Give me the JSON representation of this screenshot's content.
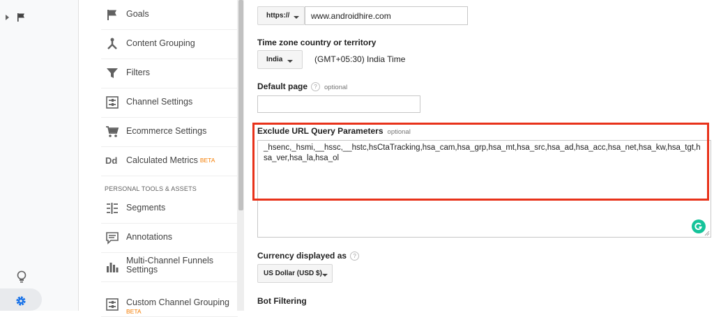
{
  "rail": {
    "icons": [
      "expand-caret-icon",
      "flag-icon",
      "lightbulb-icon",
      "gear-icon"
    ]
  },
  "nav": {
    "items": [
      {
        "label": "Goals",
        "icon": "flag-icon"
      },
      {
        "label": "Content Grouping",
        "icon": "content-grouping-icon"
      },
      {
        "label": "Filters",
        "icon": "funnel-icon"
      },
      {
        "label": "Channel Settings",
        "icon": "channel-settings-icon"
      },
      {
        "label": "Ecommerce Settings",
        "icon": "cart-icon"
      },
      {
        "label": "Calculated Metrics",
        "icon": "dd-icon",
        "badge": "BETA"
      },
      {
        "label": "Segments",
        "icon": "segments-icon"
      },
      {
        "label": "Annotations",
        "icon": "annotation-icon"
      },
      {
        "label": "Multi-Channel Funnels",
        "label_line2": "Settings",
        "icon": "bar-chart-icon"
      },
      {
        "label": "Custom Channel Grouping",
        "icon": "custom-channel-icon",
        "badge": "BETA"
      }
    ],
    "heading_personal": "PERSONAL TOOLS & ASSETS",
    "dd_glyph": "Dd"
  },
  "form": {
    "protocol": "https://",
    "website_url": "www.androidhire.com",
    "timezone_label": "Time zone country or territory",
    "country": "India",
    "timezone": "(GMT+05:30) India Time",
    "default_page_label": "Default page",
    "help_glyph": "?",
    "optional": "optional",
    "default_page_value": "",
    "exclude_label": "Exclude URL Query Parameters",
    "exclude_value": "_hsenc,_hsmi,__hssc,__hstc,hsCtaTracking,hsa_cam,hsa_grp,hsa_mt,hsa_src,hsa_ad,hsa_acc,hsa_net,hsa_kw,hsa_tgt,hsa_ver,hsa_la,hsa_ol",
    "currency_label": "Currency displayed as",
    "currency": "US Dollar (USD $)",
    "bot_filtering_label": "Bot Filtering"
  },
  "colors": {
    "highlight": "#e8321a",
    "beta": "#f57c00",
    "grammarly": "#15c39a"
  }
}
